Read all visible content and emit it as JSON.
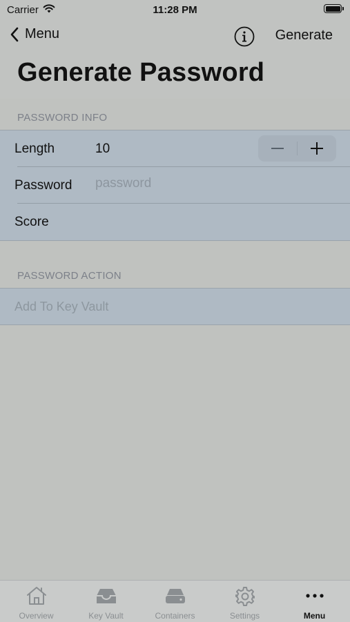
{
  "status_bar": {
    "carrier": "Carrier",
    "time": "11:28 PM"
  },
  "nav": {
    "back_label": "Menu",
    "generate_label": "Generate",
    "title": "Generate Password"
  },
  "sections": {
    "info_title": "PASSWORD INFO",
    "action_title": "PASSWORD ACTION"
  },
  "rows": {
    "length_label": "Length",
    "length_value": "10",
    "password_label": "Password",
    "password_placeholder": "password",
    "password_value": "",
    "score_label": "Score",
    "add_vault_label": "Add To Key Vault"
  },
  "tabs": [
    {
      "label": "Overview",
      "icon": "house-icon"
    },
    {
      "label": "Key Vault",
      "icon": "tray-icon"
    },
    {
      "label": "Containers",
      "icon": "drive-icon"
    },
    {
      "label": "Settings",
      "icon": "gear-icon"
    },
    {
      "label": "Menu",
      "icon": "ellipsis-icon",
      "active": true
    }
  ],
  "colors": {
    "accent": "#111111",
    "inactive_tab": "#8a8e91",
    "cell_bg": "#afbac4"
  }
}
